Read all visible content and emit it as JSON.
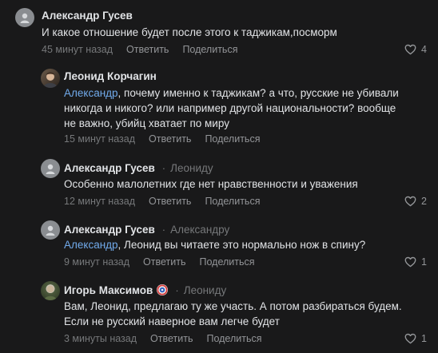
{
  "comments": [
    {
      "author": "Александр Гусев",
      "text": "И какое отношение будет после этого к таджикам,посморм",
      "time": "45 минут назад",
      "reply": "Ответить",
      "share": "Поделиться",
      "likes": "4"
    },
    {
      "author": "Леонид Корчагин",
      "mention": "Александр",
      "text_line1": ", почему именно к таджикам? а что, русские не убивали",
      "text_line2": "никогда и никого? или например другой национальности? вообще",
      "text_line3": "не важно, убийц хватает по миру",
      "time": "15 минут назад",
      "reply": "Ответить",
      "share": "Поделиться"
    },
    {
      "author": "Александр Гусев",
      "reply_to": "Леониду",
      "text": "Особенно малолетних где нет нравственности и уважения",
      "time": "12 минут назад",
      "reply": "Ответить",
      "share": "Поделиться",
      "likes": "2"
    },
    {
      "author": "Александр Гусев",
      "reply_to": "Александру",
      "mention": "Александр",
      "text": ", Леонид вы читаете это нормально нож в спину?",
      "time": "9 минут назад",
      "reply": "Ответить",
      "share": "Поделиться",
      "likes": "1"
    },
    {
      "author": "Игорь Максимов",
      "reply_to": "Леониду",
      "text_line1": "Вам, Леонид, предлагаю ту же участь. А потом разбираться будем.",
      "text_line2": "Если не русский наверное вам легче будет",
      "time": "3 минуты назад",
      "reply": "Ответить",
      "share": "Поделиться",
      "likes": "1"
    }
  ],
  "colors": {
    "background": "#19191a",
    "text": "#e1e3e6",
    "secondary": "#76787a",
    "link": "#71aaeb"
  },
  "icons": {
    "like": "heart-icon",
    "default_avatar": "user-silhouette-icon"
  }
}
